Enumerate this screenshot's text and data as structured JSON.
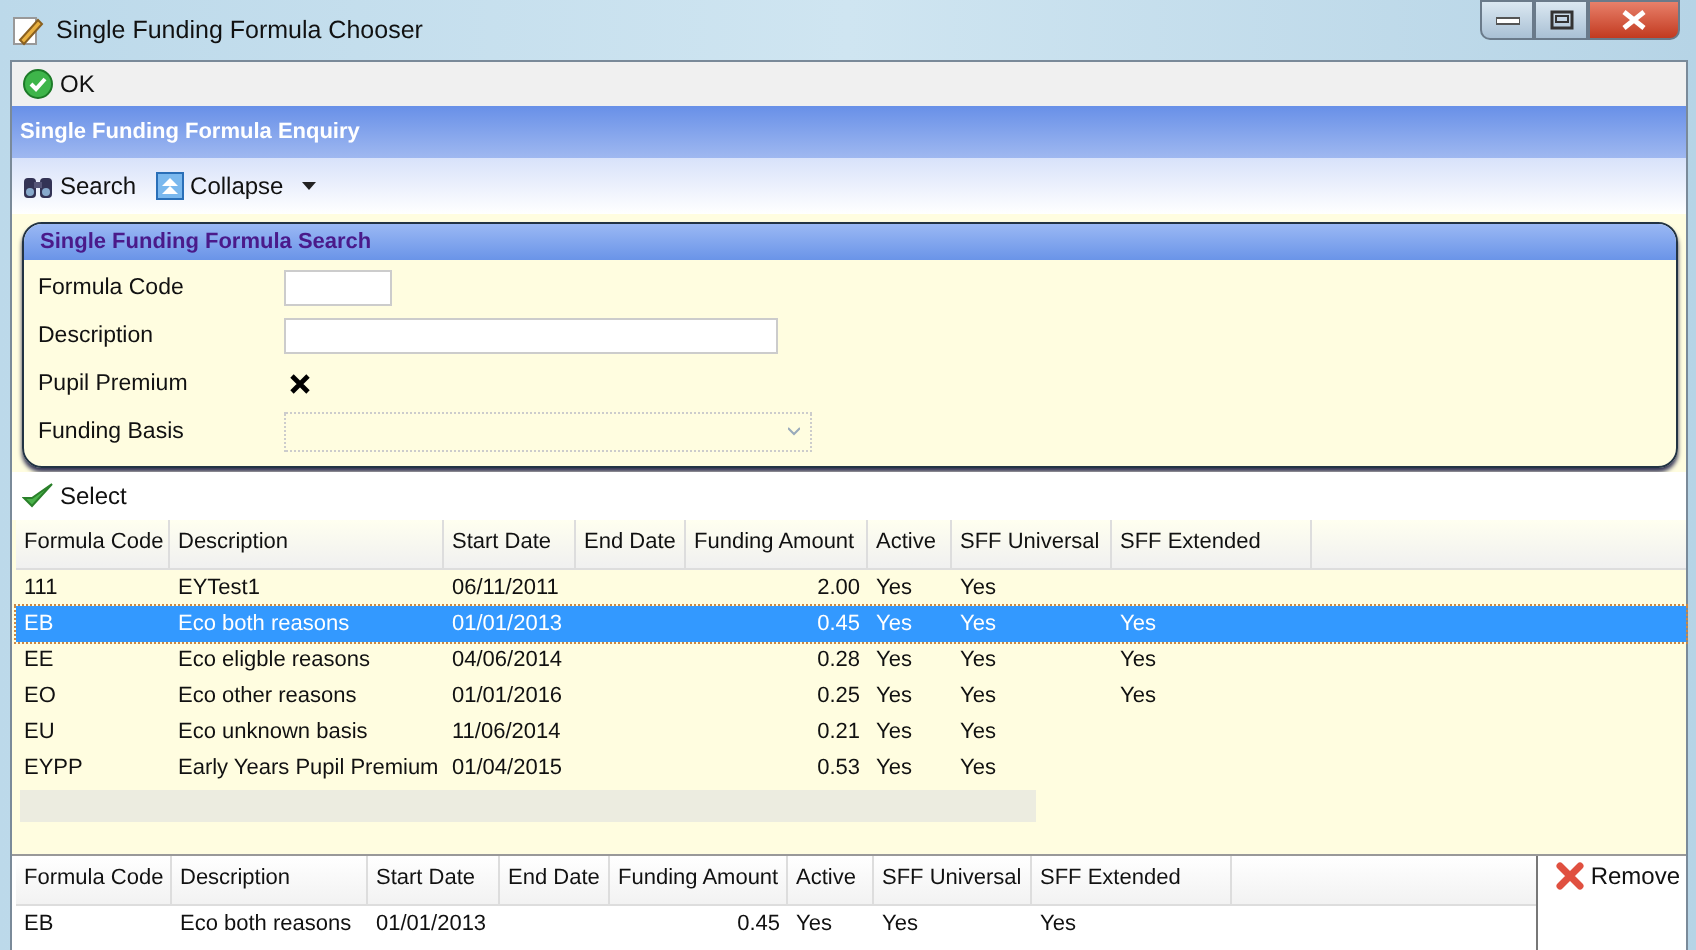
{
  "window": {
    "title": "Single Funding Formula Chooser"
  },
  "toolbar": {
    "ok_button": "OK"
  },
  "enquiry": {
    "title": "Single Funding Formula Enquiry",
    "search_button": "Search",
    "collapse_button": "Collapse"
  },
  "search_panel": {
    "title": "Single Funding Formula Search",
    "fields": [
      {
        "kind": "short_text",
        "label": "Formula Code"
      },
      {
        "kind": "long_text",
        "label": "Description"
      },
      {
        "kind": "checkbox",
        "label": "Pupil Premium",
        "checked": true
      },
      {
        "kind": "dropdown",
        "label": "Funding Basis",
        "disabled": true
      }
    ]
  },
  "select_button": "Select",
  "results_table": {
    "columns": [
      "Formula Code",
      "Description",
      "Start Date",
      "End Date",
      "Funding Amount",
      "Active",
      "SFF Universal",
      "SFF Extended"
    ],
    "rows": [
      {
        "cells": [
          "111",
          "EYTest1",
          "06/11/2011",
          "",
          "2.00",
          "Yes",
          "Yes",
          ""
        ],
        "selected": false
      },
      {
        "cells": [
          "EB",
          "Eco both reasons",
          "01/01/2013",
          "",
          "0.45",
          "Yes",
          "Yes",
          "Yes"
        ],
        "selected": true
      },
      {
        "cells": [
          "EE",
          "Eco eligble reasons",
          "04/06/2014",
          "",
          "0.28",
          "Yes",
          "Yes",
          "Yes"
        ],
        "selected": false
      },
      {
        "cells": [
          "EO",
          "Eco other reasons",
          "01/01/2016",
          "",
          "0.25",
          "Yes",
          "Yes",
          "Yes"
        ],
        "selected": false
      },
      {
        "cells": [
          "EU",
          "Eco unknown basis",
          "11/06/2014",
          "",
          "0.21",
          "Yes",
          "Yes",
          ""
        ],
        "selected": false
      },
      {
        "cells": [
          "EYPP",
          "Early Years Pupil Premium",
          "01/04/2015",
          "",
          "0.53",
          "Yes",
          "Yes",
          ""
        ],
        "selected": false
      }
    ]
  },
  "chosen_table": {
    "columns": [
      "Formula Code",
      "Description",
      "Start Date",
      "End Date",
      "Funding Amount",
      "Active",
      "SFF Universal",
      "SFF Extended"
    ],
    "rows": [
      {
        "cells": [
          "EB",
          "Eco both reasons",
          "01/01/2013",
          "",
          "0.45",
          "Yes",
          "Yes",
          "Yes"
        ]
      }
    ]
  },
  "remove_button": "Remove"
}
